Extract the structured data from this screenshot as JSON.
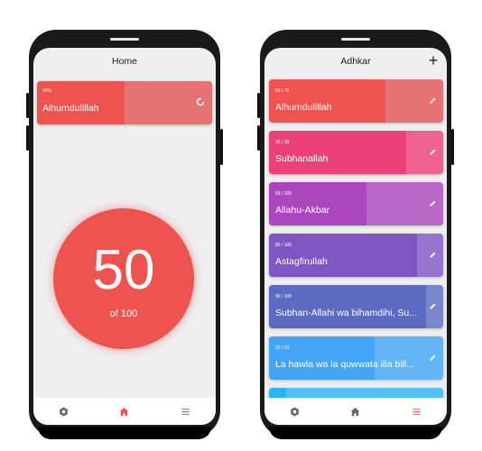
{
  "home": {
    "title": "Home",
    "card": {
      "percent_label": "50%",
      "title": "Alhumdulillah",
      "progress": 0.5,
      "bg": "#e57373",
      "fill": "#ef5350"
    },
    "counter": {
      "count": "50",
      "target_label": "of 100",
      "color": "#ef5350"
    },
    "nav": [
      {
        "icon": "settings-icon",
        "active": false
      },
      {
        "icon": "home-icon",
        "active": true
      },
      {
        "icon": "list-icon",
        "active": false
      }
    ]
  },
  "adhkar": {
    "title": "Adhkar",
    "add_label": "+",
    "items": [
      {
        "progress_label": "50 / 75",
        "title": "Alhumdulillah",
        "progress": 0.6667,
        "fill": "#ef5350",
        "bg": "#e57373"
      },
      {
        "progress_label": "26 / 33",
        "title": "Subhanallah",
        "progress": 0.7879,
        "fill": "#ec407a",
        "bg": "#f06292"
      },
      {
        "progress_label": "56 / 100",
        "title": "Allahu-Akbar",
        "progress": 0.56,
        "fill": "#ab47bc",
        "bg": "#ba68c8"
      },
      {
        "progress_label": "85 / 100",
        "title": "Astagfirullah",
        "progress": 0.85,
        "fill": "#7e57c2",
        "bg": "#9575cd"
      },
      {
        "progress_label": "90 / 100",
        "title": "Subhan-Allahi wa bihamdihi, Su...",
        "progress": 0.9,
        "fill": "#5c6bc0",
        "bg": "#7986cb"
      },
      {
        "progress_label": "20 / 33",
        "title": "La hawla wa la quwwata illa bill...",
        "progress": 0.6061,
        "fill": "#42a5f5",
        "bg": "#64b5f6"
      },
      {
        "progress_label": "",
        "title": "",
        "progress": 0.1,
        "fill": "#29b6f6",
        "bg": "#4fc3f7"
      }
    ],
    "nav": [
      {
        "icon": "settings-icon",
        "active": false
      },
      {
        "icon": "home-icon",
        "active": false
      },
      {
        "icon": "list-icon",
        "active": true
      }
    ]
  }
}
